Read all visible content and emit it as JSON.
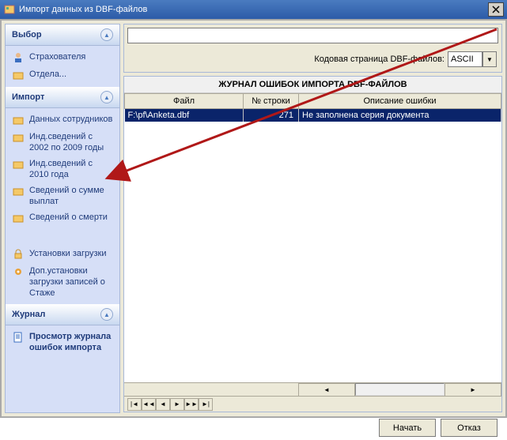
{
  "window": {
    "title": "Импорт данных из DBF-файлов"
  },
  "sidebar": {
    "groups": {
      "vybor": {
        "title": "Выбор",
        "items": [
          {
            "label": "Страхователя"
          },
          {
            "label": "Отдела..."
          }
        ]
      },
      "import": {
        "title": "Импорт",
        "items": [
          {
            "label": "Данных сотрудников"
          },
          {
            "label": "Инд.сведений с 2002 по 2009 годы"
          },
          {
            "label": "Инд.сведений с 2010 года"
          },
          {
            "label": "Сведений о сумме выплат"
          },
          {
            "label": "Сведений о смерти"
          },
          {
            "label": "Установки загрузки"
          },
          {
            "label": "Доп.установки загрузки записей о Стаже"
          }
        ]
      },
      "journal": {
        "title": "Журнал",
        "items": [
          {
            "label": "Просмотр журнала ошибок импорта"
          }
        ]
      }
    }
  },
  "top": {
    "path_value": "",
    "encoding_label": "Кодовая страница DBF-файлов:",
    "encoding_value": "ASCII"
  },
  "journal_panel": {
    "title": "ЖУРНАЛ ОШИБОК ИМПОРТА DBF-ФАЙЛОВ",
    "columns": {
      "file": "Файл",
      "line": "№ строки",
      "desc": "Описание ошибки"
    },
    "rows": [
      {
        "file": "F:\\pf\\Anketa.dbf",
        "line": "271",
        "desc": "Не заполнена серия документа"
      }
    ]
  },
  "buttons": {
    "start": "Начать",
    "cancel": "Отказ"
  }
}
